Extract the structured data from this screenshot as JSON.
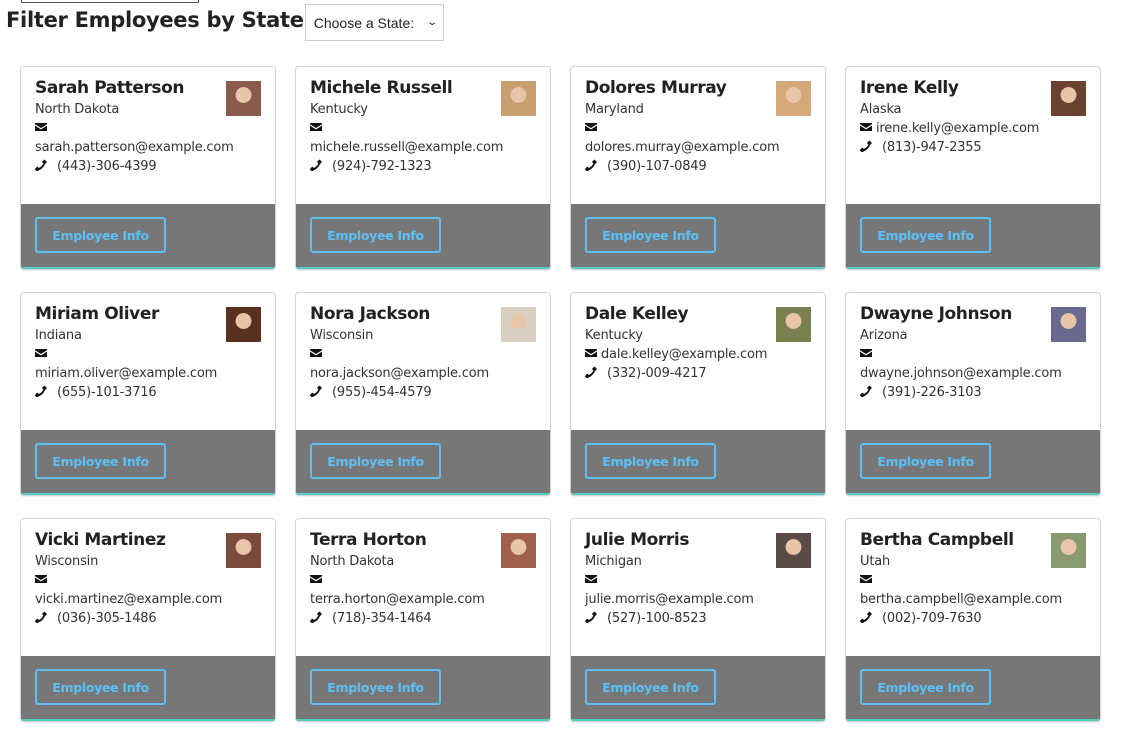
{
  "header": {
    "title": "Filter Employees by State",
    "state_select": {
      "selected": "Choose a State:"
    }
  },
  "button_label": "Employee Info",
  "colors": {
    "accent": "#5bc0f8",
    "footer": "#777777",
    "edge": "#4ecdc4"
  },
  "employees": [
    {
      "name": "Sarah Patterson",
      "state": "North Dakota",
      "email": "sarah.patterson@example.com",
      "phone": "(443)-306-4399",
      "avatar": "#8a5a4a",
      "inline": false
    },
    {
      "name": "Michele Russell",
      "state": "Kentucky",
      "email": "michele.russell@example.com",
      "phone": "(924)-792-1323",
      "avatar": "#c8a070",
      "inline": false
    },
    {
      "name": "Dolores Murray",
      "state": "Maryland",
      "email": "dolores.murray@example.com",
      "phone": "(390)-107-0849",
      "avatar": "#d4a878",
      "inline": false
    },
    {
      "name": "Irene Kelly",
      "state": "Alaska",
      "email": "irene.kelly@example.com",
      "phone": "(813)-947-2355",
      "avatar": "#6a4030",
      "inline": true
    },
    {
      "name": "Miriam Oliver",
      "state": "Indiana",
      "email": "miriam.oliver@example.com",
      "phone": "(655)-101-3716",
      "avatar": "#5a3020",
      "inline": false
    },
    {
      "name": "Nora Jackson",
      "state": "Wisconsin",
      "email": "nora.jackson@example.com",
      "phone": "(955)-454-4579",
      "avatar": "#d8cfc2",
      "inline": false
    },
    {
      "name": "Dale Kelley",
      "state": "Kentucky",
      "email": "dale.kelley@example.com",
      "phone": "(332)-009-4217",
      "avatar": "#7a8050",
      "inline": true
    },
    {
      "name": "Dwayne Johnson",
      "state": "Arizona",
      "email": "dwayne.johnson@example.com",
      "phone": "(391)-226-3103",
      "avatar": "#6a6a90",
      "inline": false
    },
    {
      "name": "Vicki Martinez",
      "state": "Wisconsin",
      "email": "vicki.martinez@example.com",
      "phone": "(036)-305-1486",
      "avatar": "#7a4a3a",
      "inline": false
    },
    {
      "name": "Terra Horton",
      "state": "North Dakota",
      "email": "terra.horton@example.com",
      "phone": "(718)-354-1464",
      "avatar": "#a06050",
      "inline": false
    },
    {
      "name": "Julie Morris",
      "state": "Michigan",
      "email": "julie.morris@example.com",
      "phone": "(527)-100-8523",
      "avatar": "#5a4a48",
      "inline": false
    },
    {
      "name": "Bertha Campbell",
      "state": "Utah",
      "email": "bertha.campbell@example.com",
      "phone": "(002)-709-7630",
      "avatar": "#8a9a70",
      "inline": false
    }
  ]
}
